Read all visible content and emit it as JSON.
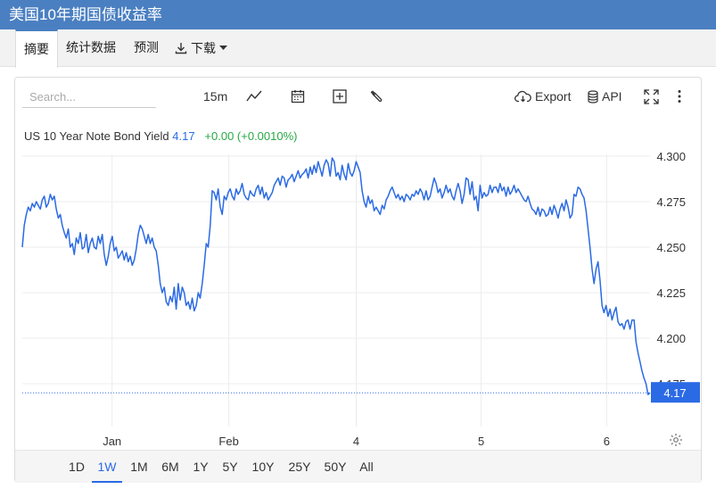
{
  "header": {
    "title": "美国10年期国债收益率"
  },
  "tabs": [
    {
      "label": "摘要"
    },
    {
      "label": "统计数据"
    },
    {
      "label": "预测"
    },
    {
      "label": "下载"
    }
  ],
  "toolbar": {
    "search_placeholder": "Search...",
    "interval": "15m",
    "export_label": "Export",
    "api_label": "API"
  },
  "legend": {
    "symbol": "US 10 Year Note Bond Yield",
    "value": "4.17",
    "change": "+0.00 (+0.0010%)"
  },
  "last_value_label": "4.17",
  "ranges": [
    "1D",
    "1W",
    "1M",
    "6M",
    "1Y",
    "5Y",
    "10Y",
    "25Y",
    "50Y",
    "All"
  ],
  "active_range": "1W",
  "colors": {
    "line": "#2b6ae5",
    "header": "#4a7fc1",
    "change_positive": "#27a844"
  },
  "chart_data": {
    "type": "line",
    "title": "US 10 Year Note Bond Yield",
    "x_tick_labels": [
      "Jan",
      "Feb",
      "4",
      "5",
      "6"
    ],
    "y_tick_labels": [
      "4.175",
      "4.200",
      "4.225",
      "4.250",
      "4.275",
      "4.300"
    ],
    "ylim": [
      4.16,
      4.305
    ],
    "grid": true,
    "last_value": 4.17,
    "series": [
      {
        "values": [
          4.25,
          4.262,
          4.268,
          4.272,
          4.27,
          4.274,
          4.272,
          4.275,
          4.273,
          4.271,
          4.276,
          4.278,
          4.272,
          4.274,
          4.279,
          4.276,
          4.278,
          4.271,
          4.266,
          4.268,
          4.262,
          4.258,
          4.255,
          4.26,
          4.25,
          4.252,
          4.246,
          4.255,
          4.252,
          4.258,
          4.249,
          4.25,
          4.257,
          4.247,
          4.252,
          4.255,
          4.25,
          4.249,
          4.256,
          4.252,
          4.257,
          4.246,
          4.24,
          4.245,
          4.252,
          4.256,
          4.248,
          4.25,
          4.244,
          4.246,
          4.248,
          4.243,
          4.247,
          4.242,
          4.245,
          4.24,
          4.243,
          4.249,
          4.257,
          4.262,
          4.26,
          4.256,
          4.252,
          4.257,
          4.252,
          4.255,
          4.25,
          4.248,
          4.24,
          4.23,
          4.225,
          4.228,
          4.22,
          4.218,
          4.223,
          4.22,
          4.228,
          4.216,
          4.23,
          4.221,
          4.228,
          4.225,
          4.218,
          4.22,
          4.216,
          4.222,
          4.215,
          4.218,
          4.225,
          4.222,
          4.23,
          4.24,
          4.252,
          4.25,
          4.262,
          4.281,
          4.28,
          4.276,
          4.282,
          4.272,
          4.268,
          4.278,
          4.276,
          4.28,
          4.282,
          4.278,
          4.276,
          4.282,
          4.279,
          4.281,
          4.285,
          4.279,
          4.277,
          4.276,
          4.281,
          4.279,
          4.278,
          4.282,
          4.284,
          4.279,
          4.283,
          4.277,
          4.28,
          4.276,
          4.278,
          4.28,
          4.284,
          4.286,
          4.288,
          4.284,
          4.289,
          4.288,
          4.283,
          4.287,
          4.288,
          4.29,
          4.286,
          4.289,
          4.292,
          4.288,
          4.29,
          4.291,
          4.293,
          4.288,
          4.294,
          4.29,
          4.295,
          4.291,
          4.297,
          4.293,
          4.289,
          4.295,
          4.298,
          4.296,
          4.289,
          4.299,
          4.297,
          4.289,
          4.291,
          4.287,
          4.295,
          4.29,
          4.287,
          4.296,
          4.291,
          4.289,
          4.292,
          4.297,
          4.294,
          4.291,
          4.281,
          4.275,
          4.272,
          4.278,
          4.274,
          4.276,
          4.27,
          4.272,
          4.27,
          4.268,
          4.273,
          4.271,
          4.276,
          4.278,
          4.281,
          4.283,
          4.28,
          4.277,
          4.279,
          4.276,
          4.278,
          4.275,
          4.279,
          4.278,
          4.276,
          4.279,
          4.278,
          4.281,
          4.279,
          4.282,
          4.28,
          4.276,
          4.281,
          4.276,
          4.278,
          4.283,
          4.288,
          4.285,
          4.28,
          4.282,
          4.277,
          4.28,
          4.284,
          4.28,
          4.282,
          4.278,
          4.276,
          4.281,
          4.285,
          4.281,
          4.274,
          4.279,
          4.288,
          4.287,
          4.279,
          4.286,
          4.276,
          4.278,
          4.27,
          4.284,
          4.277,
          4.28,
          4.278,
          4.279,
          4.284,
          4.28,
          4.283,
          4.283,
          4.28,
          4.285,
          4.281,
          4.283,
          4.278,
          4.283,
          4.279,
          4.281,
          4.284,
          4.28,
          4.282,
          4.28,
          4.278,
          4.276,
          4.275,
          4.278,
          4.274,
          4.271,
          4.27,
          4.268,
          4.272,
          4.267,
          4.271,
          4.27,
          4.267,
          4.268,
          4.272,
          4.268,
          4.273,
          4.27,
          4.266,
          4.271,
          4.274,
          4.27,
          4.276,
          4.272,
          4.266,
          4.268,
          4.279,
          4.278,
          4.283,
          4.282,
          4.279,
          4.277,
          4.27,
          4.26,
          4.25,
          4.238,
          4.23,
          4.238,
          4.242,
          4.232,
          4.218,
          4.214,
          4.218,
          4.212,
          4.216,
          4.21,
          4.214,
          4.217,
          4.209,
          4.207,
          4.208,
          4.205,
          4.209,
          4.21,
          4.205,
          4.21,
          4.21,
          4.198,
          4.192,
          4.187,
          4.182,
          4.178,
          4.175,
          4.169,
          4.17
        ]
      }
    ]
  }
}
